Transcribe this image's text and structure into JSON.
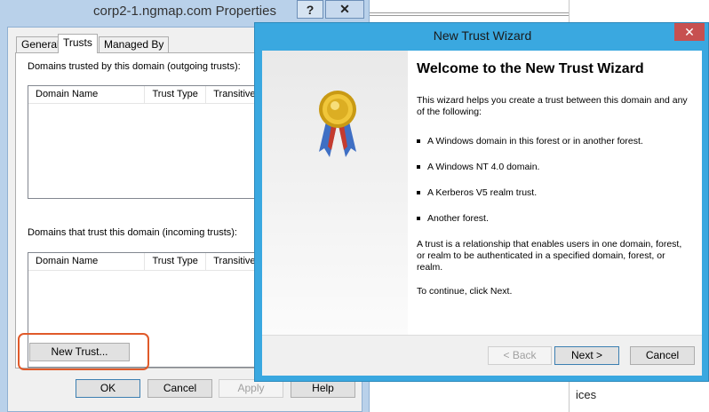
{
  "background": {
    "fragment_text": "ices"
  },
  "properties_dialog": {
    "title": "corp2-1.ngmap.com Properties",
    "help_glyph": "?",
    "close_glyph": "✕",
    "tabs": [
      {
        "label": "General"
      },
      {
        "label": "Trusts",
        "active": true
      },
      {
        "label": "Managed By"
      }
    ],
    "outgoing": {
      "label": "Domains trusted by this domain (outgoing trusts):",
      "columns": [
        "Domain Name",
        "Trust Type",
        "Transitive"
      ]
    },
    "incoming": {
      "label": "Domains that trust this domain (incoming trusts):",
      "columns": [
        "Domain Name",
        "Trust Type",
        "Transitive"
      ]
    },
    "new_trust_label": "New Trust...",
    "ok_label": "OK",
    "cancel_label": "Cancel",
    "apply_label": "Apply",
    "help_label": "Help"
  },
  "wizard": {
    "title": "New Trust Wizard",
    "close_glyph": "✕",
    "heading": "Welcome to the New Trust Wizard",
    "intro": "This wizard helps you create a trust between this domain and any of the following:",
    "bullets": [
      "A Windows domain in this forest or in another forest.",
      "A Windows NT 4.0 domain.",
      "A Kerberos V5 realm trust.",
      "Another forest."
    ],
    "description": "A trust is a relationship that enables users in one domain, forest, or realm to be authenticated in a specified domain, forest, or realm.",
    "continue_text": "To continue, click Next.",
    "back_label": "< Back",
    "next_label": "Next >",
    "cancel_label": "Cancel"
  },
  "colors": {
    "wizard_frame": "#3aa8e0",
    "dialog_frame": "#b9d1ea",
    "highlight": "#e05a2a",
    "close_red": "#c75050"
  }
}
